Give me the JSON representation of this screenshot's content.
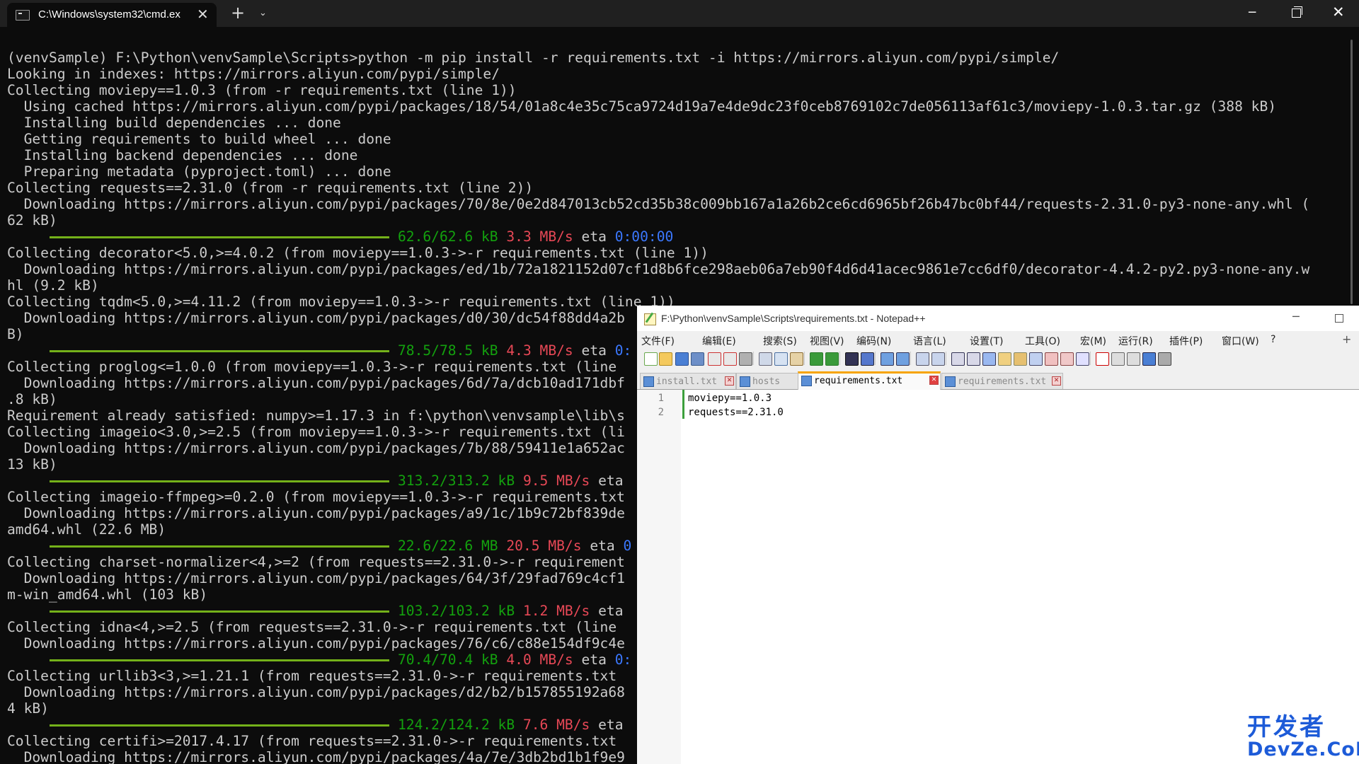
{
  "terminal": {
    "tab_title": "C:\\Windows\\system32\\cmd.ex",
    "lines": [
      {
        "t": "(venvSample) F:\\Python\\venvSample\\Scripts>python -m pip install -r requirements.txt -i https://mirrors.aliyun.com/pypi/simple/"
      },
      {
        "t": "Looking in indexes: https://mirrors.aliyun.com/pypi/simple/"
      },
      {
        "t": "Collecting moviepy==1.0.3 (from -r requirements.txt (line 1))"
      },
      {
        "t": "  Using cached https://mirrors.aliyun.com/pypi/packages/18/54/01a8c4e35c75ca9724d19a7e4de9dc23f0ceb8769102c7de056113af61c3/moviepy-1.0.3.tar.gz (388 kB)"
      },
      {
        "t": "  Installing build dependencies ... done"
      },
      {
        "t": "  Getting requirements to build wheel ... done"
      },
      {
        "t": "  Installing backend dependencies ... done"
      },
      {
        "t": "  Preparing metadata (pyproject.toml) ... done"
      },
      {
        "t": "Collecting requests==2.31.0 (from -r requirements.txt (line 2))"
      },
      {
        "t": "  Downloading https://mirrors.aliyun.com/pypi/packages/70/8e/0e2d847013cb52cd35b38c009bb167a1a26b2ce6cd6965bf26b47bc0bf44/requests-2.31.0-py3-none-any.whl ("
      },
      {
        "t": "62 kB)"
      },
      {
        "p": {
          "size": "62.6/62.6 kB",
          "speed": "3.3 MB/s",
          "eta_label": "eta",
          "eta": "0:00:00"
        }
      },
      {
        "t": "Collecting decorator<5.0,>=4.0.2 (from moviepy==1.0.3->-r requirements.txt (line 1))"
      },
      {
        "t": "  Downloading https://mirrors.aliyun.com/pypi/packages/ed/1b/72a1821152d07cf1d8b6fce298aeb06a7eb90f4d6d41acec9861e7cc6df0/decorator-4.4.2-py2.py3-none-any.w"
      },
      {
        "t": "hl (9.2 kB)"
      },
      {
        "t": "Collecting tqdm<5.0,>=4.11.2 (from moviepy==1.0.3->-r requirements.txt (line 1))"
      },
      {
        "t": "  Downloading https://mirrors.aliyun.com/pypi/packages/d0/30/dc54f88dd4a2b"
      },
      {
        "t": "B)"
      },
      {
        "p": {
          "size": "78.5/78.5 kB",
          "speed": "4.3 MB/s",
          "eta_label": "eta",
          "eta": "0:"
        }
      },
      {
        "t": "Collecting proglog<=1.0.0 (from moviepy==1.0.3->-r requirements.txt (line"
      },
      {
        "t": "  Downloading https://mirrors.aliyun.com/pypi/packages/6d/7a/dcb10ad171dbf"
      },
      {
        "t": ".8 kB)"
      },
      {
        "t": "Requirement already satisfied: numpy>=1.17.3 in f:\\python\\venvsample\\lib\\s"
      },
      {
        "t": "Collecting imageio<3.0,>=2.5 (from moviepy==1.0.3->-r requirements.txt (li"
      },
      {
        "t": "  Downloading https://mirrors.aliyun.com/pypi/packages/7b/88/59411e1a652ac"
      },
      {
        "t": "13 kB)"
      },
      {
        "p": {
          "size": "313.2/313.2 kB",
          "speed": "9.5 MB/s",
          "eta_label": "eta",
          "eta": ""
        }
      },
      {
        "t": "Collecting imageio-ffmpeg>=0.2.0 (from moviepy==1.0.3->-r requirements.txt"
      },
      {
        "t": "  Downloading https://mirrors.aliyun.com/pypi/packages/a9/1c/1b9c72bf839de"
      },
      {
        "t": "amd64.whl (22.6 MB)"
      },
      {
        "p": {
          "size": "22.6/22.6 MB",
          "speed": "20.5 MB/s",
          "eta_label": "eta",
          "eta": "0"
        }
      },
      {
        "t": "Collecting charset-normalizer<4,>=2 (from requests==2.31.0->-r requirement"
      },
      {
        "t": "  Downloading https://mirrors.aliyun.com/pypi/packages/64/3f/29fad769c4cf1"
      },
      {
        "t": "m-win_amd64.whl (103 kB)"
      },
      {
        "p": {
          "size": "103.2/103.2 kB",
          "speed": "1.2 MB/s",
          "eta_label": "eta",
          "eta": ""
        }
      },
      {
        "t": "Collecting idna<4,>=2.5 (from requests==2.31.0->-r requirements.txt (line"
      },
      {
        "t": "  Downloading https://mirrors.aliyun.com/pypi/packages/76/c6/c88e154df9c4e"
      },
      {
        "p": {
          "size": "70.4/70.4 kB",
          "speed": "4.0 MB/s",
          "eta_label": "eta",
          "eta": "0:"
        }
      },
      {
        "t": "Collecting urllib3<3,>=1.21.1 (from requests==2.31.0->-r requirements.txt"
      },
      {
        "t": "  Downloading https://mirrors.aliyun.com/pypi/packages/d2/b2/b157855192a68"
      },
      {
        "t": "4 kB)"
      },
      {
        "p": {
          "size": "124.2/124.2 kB",
          "speed": "7.6 MB/s",
          "eta_label": "eta",
          "eta": ""
        }
      },
      {
        "t": "Collecting certifi>=2017.4.17 (from requests==2.31.0->-r requirements.txt"
      },
      {
        "t": "  Downloading https://mirrors.aliyun.com/pypi/packages/4a/7e/3db2bd1b1f9e9"
      }
    ]
  },
  "notepad": {
    "title": "F:\\Python\\venvSample\\Scripts\\requirements.txt - Notepad++",
    "menu": [
      "文件(F)",
      "编辑(E)",
      "搜索(S)",
      "视图(V)",
      "编码(N)",
      "语言(L)",
      "设置(T)",
      "工具(O)",
      "宏(M)",
      "运行(R)",
      "插件(P)",
      "窗口(W)",
      "?"
    ],
    "menu_plus": "+",
    "tabs": [
      {
        "label": "install.txt",
        "active": false
      },
      {
        "label": "hosts",
        "active": false
      },
      {
        "label": "requirements.txt",
        "active": true
      },
      {
        "label": "requirements.txt",
        "active": false
      }
    ],
    "lines": [
      {
        "num": "1",
        "code": "moviepy==1.0.3"
      },
      {
        "num": "2",
        "code": "requests==2.31.0"
      }
    ]
  },
  "watermark": {
    "top": "开发者",
    "bottom": "DevZe.CoM"
  }
}
